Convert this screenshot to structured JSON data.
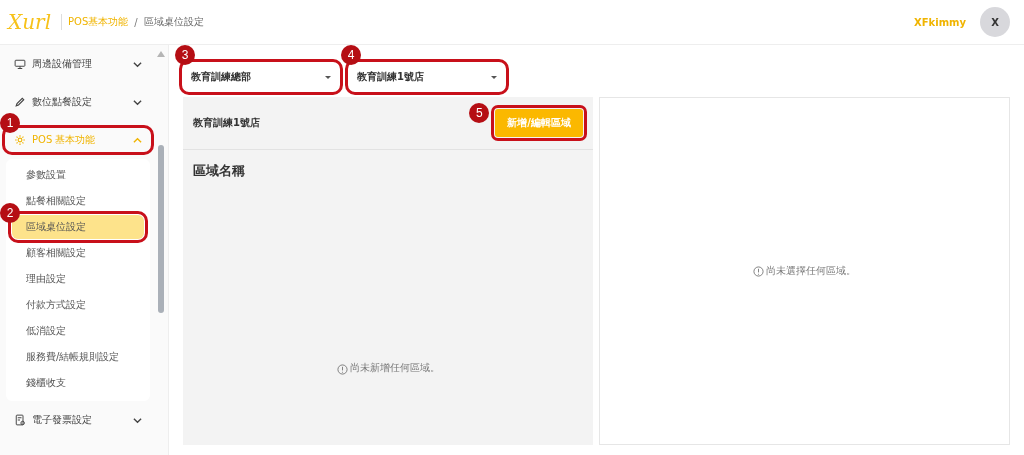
{
  "header": {
    "logo": "Xurl",
    "breadcrumb": [
      {
        "label": "POS基本功能",
        "selected": false
      },
      {
        "label": "區域桌位設定",
        "selected": true
      }
    ],
    "separator": "/",
    "user": "XFkimmy",
    "avatar": "X"
  },
  "sidebar": {
    "items": [
      {
        "label": "周邊設備管理",
        "expanded": false
      },
      {
        "label": "數位點餐設定",
        "expanded": false
      },
      {
        "label": "POS 基本功能",
        "expanded": true,
        "callout": "1",
        "children": [
          {
            "label": "參數設置",
            "selected": false
          },
          {
            "label": "點餐相關設定",
            "selected": false
          },
          {
            "label": "區域桌位設定",
            "selected": true,
            "callout": "2"
          },
          {
            "label": "顧客相關設定",
            "selected": false
          },
          {
            "label": "理由設定",
            "selected": false
          },
          {
            "label": "付款方式設定",
            "selected": false
          },
          {
            "label": "低消設定",
            "selected": false
          },
          {
            "label": "服務費/結帳規則設定",
            "selected": false
          },
          {
            "label": "錢櫃收支",
            "selected": false
          }
        ]
      },
      {
        "label": "電子發票設定",
        "expanded": false
      }
    ]
  },
  "filters": [
    {
      "value": "教育訓練總部",
      "callout": "3"
    },
    {
      "value": "教育訓練1號店",
      "callout": "4"
    }
  ],
  "area_panel": {
    "store": "教育訓練1號店",
    "button": {
      "label": "新增/編輯區域",
      "callout": "5"
    },
    "heading": "區域名稱",
    "empty_message": "尚未新增任何區域。"
  },
  "detail_panel": {
    "empty_message": "尚未選擇任何區域。"
  }
}
